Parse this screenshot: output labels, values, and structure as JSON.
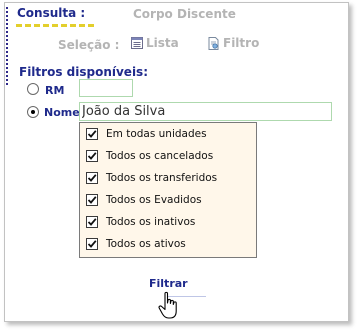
{
  "header": {
    "consulta_label": "Consulta :",
    "corpo_label": "Corpo Discente"
  },
  "selection": {
    "label": "Seleção :",
    "lista_label": "Lista",
    "filtro_label": "Filtro"
  },
  "filters": {
    "title": "Filtros disponíveis:",
    "rm_label": "RM",
    "rm_value": "",
    "nome_label": "Nome",
    "nome_value": "João da Silva",
    "selected_radio": "Nome"
  },
  "options": [
    {
      "label": "Em todas unidades",
      "checked": true
    },
    {
      "label": "Todos os cancelados",
      "checked": true
    },
    {
      "label": "Todos os transferidos",
      "checked": true
    },
    {
      "label": "Todos os Evadidos",
      "checked": true
    },
    {
      "label": "Todos os inativos",
      "checked": true
    },
    {
      "label": "Todos os ativos",
      "checked": true
    }
  ],
  "actions": {
    "filtrar_label": "Filtrar"
  },
  "colors": {
    "label_blue": "#1f2a8c",
    "muted_gray": "#b4b4b4",
    "accent_yellow": "#e3cf2c",
    "panel_bg": "#fff7ea",
    "input_border": "#aed9ae"
  }
}
